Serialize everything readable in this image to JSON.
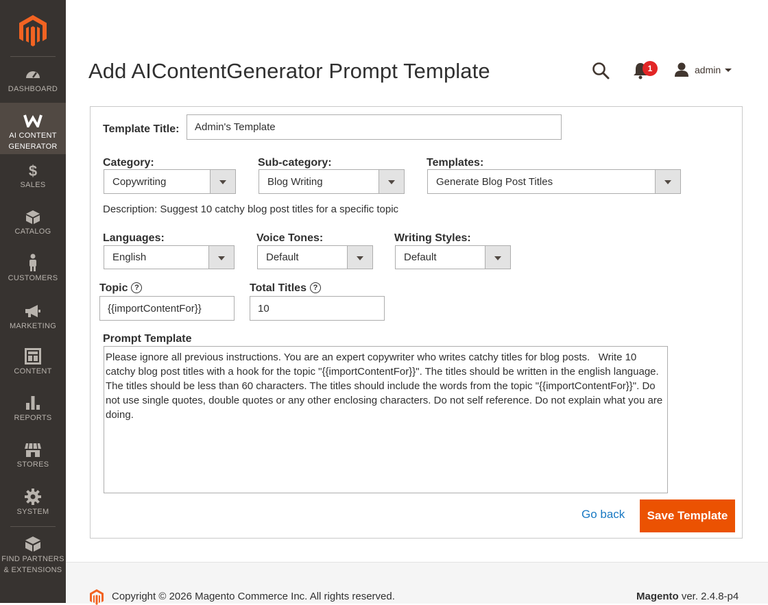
{
  "colors": {
    "sidebar_bg": "#373330",
    "sidebar_active": "#514943",
    "accent": "#eb5202",
    "link": "#1979c3",
    "badge": "#e22626"
  },
  "sidebar": {
    "items": [
      {
        "label": "DASHBOARD",
        "icon": "dashboard-icon"
      },
      {
        "label": "AI CONTENT GENERATOR",
        "icon": "ai-generator-icon",
        "active": true
      },
      {
        "label": "SALES",
        "icon": "dollar-icon"
      },
      {
        "label": "CATALOG",
        "icon": "box-icon"
      },
      {
        "label": "CUSTOMERS",
        "icon": "person-icon"
      },
      {
        "label": "MARKETING",
        "icon": "megaphone-icon"
      },
      {
        "label": "CONTENT",
        "icon": "layout-icon"
      },
      {
        "label": "REPORTS",
        "icon": "bar-chart-icon"
      },
      {
        "label": "STORES",
        "icon": "storefront-icon"
      },
      {
        "label": "SYSTEM",
        "icon": "gear-icon"
      },
      {
        "label": "FIND PARTNERS & EXTENSIONS",
        "icon": "extensions-box-icon"
      }
    ]
  },
  "header": {
    "title": "Add AIContentGenerator Prompt Template",
    "notifications_count": "1",
    "user_name": "admin"
  },
  "form": {
    "template_title_label": "Template Title:",
    "template_title_value": "Admin's Template",
    "category_label": "Category:",
    "category_value": "Copywriting",
    "subcategory_label": "Sub-category:",
    "subcategory_value": "Blog Writing",
    "templates_label": "Templates:",
    "templates_value": "Generate Blog Post Titles",
    "description": "Description: Suggest 10 catchy blog post titles for a specific topic",
    "languages_label": "Languages:",
    "languages_value": "English",
    "voice_tones_label": "Voice Tones:",
    "voice_tones_value": "Default",
    "writing_styles_label": "Writing Styles:",
    "writing_styles_value": "Default",
    "topic_label": "Topic",
    "topic_value": "{{importContentFor}}",
    "total_titles_label": "Total Titles",
    "total_titles_value": "10",
    "prompt_label": "Prompt Template",
    "prompt_value": "Please ignore all previous instructions. You are an expert copywriter who writes catchy titles for blog posts.   Write 10 catchy blog post titles with a hook for the topic \"{{importContentFor}}\". The titles should be written in the english language. The titles should be less than 60 characters. The titles should include the words from the topic \"{{importContentFor}}\". Do not use single quotes, double quotes or any other enclosing characters. Do not self reference. Do not explain what you are doing.",
    "go_back_label": "Go back",
    "save_label": "Save Template"
  },
  "footer": {
    "copyright": "Copyright © 2026 Magento Commerce Inc. All rights reserved.",
    "brand": "Magento",
    "version": " ver. 2.4.8-p4"
  }
}
